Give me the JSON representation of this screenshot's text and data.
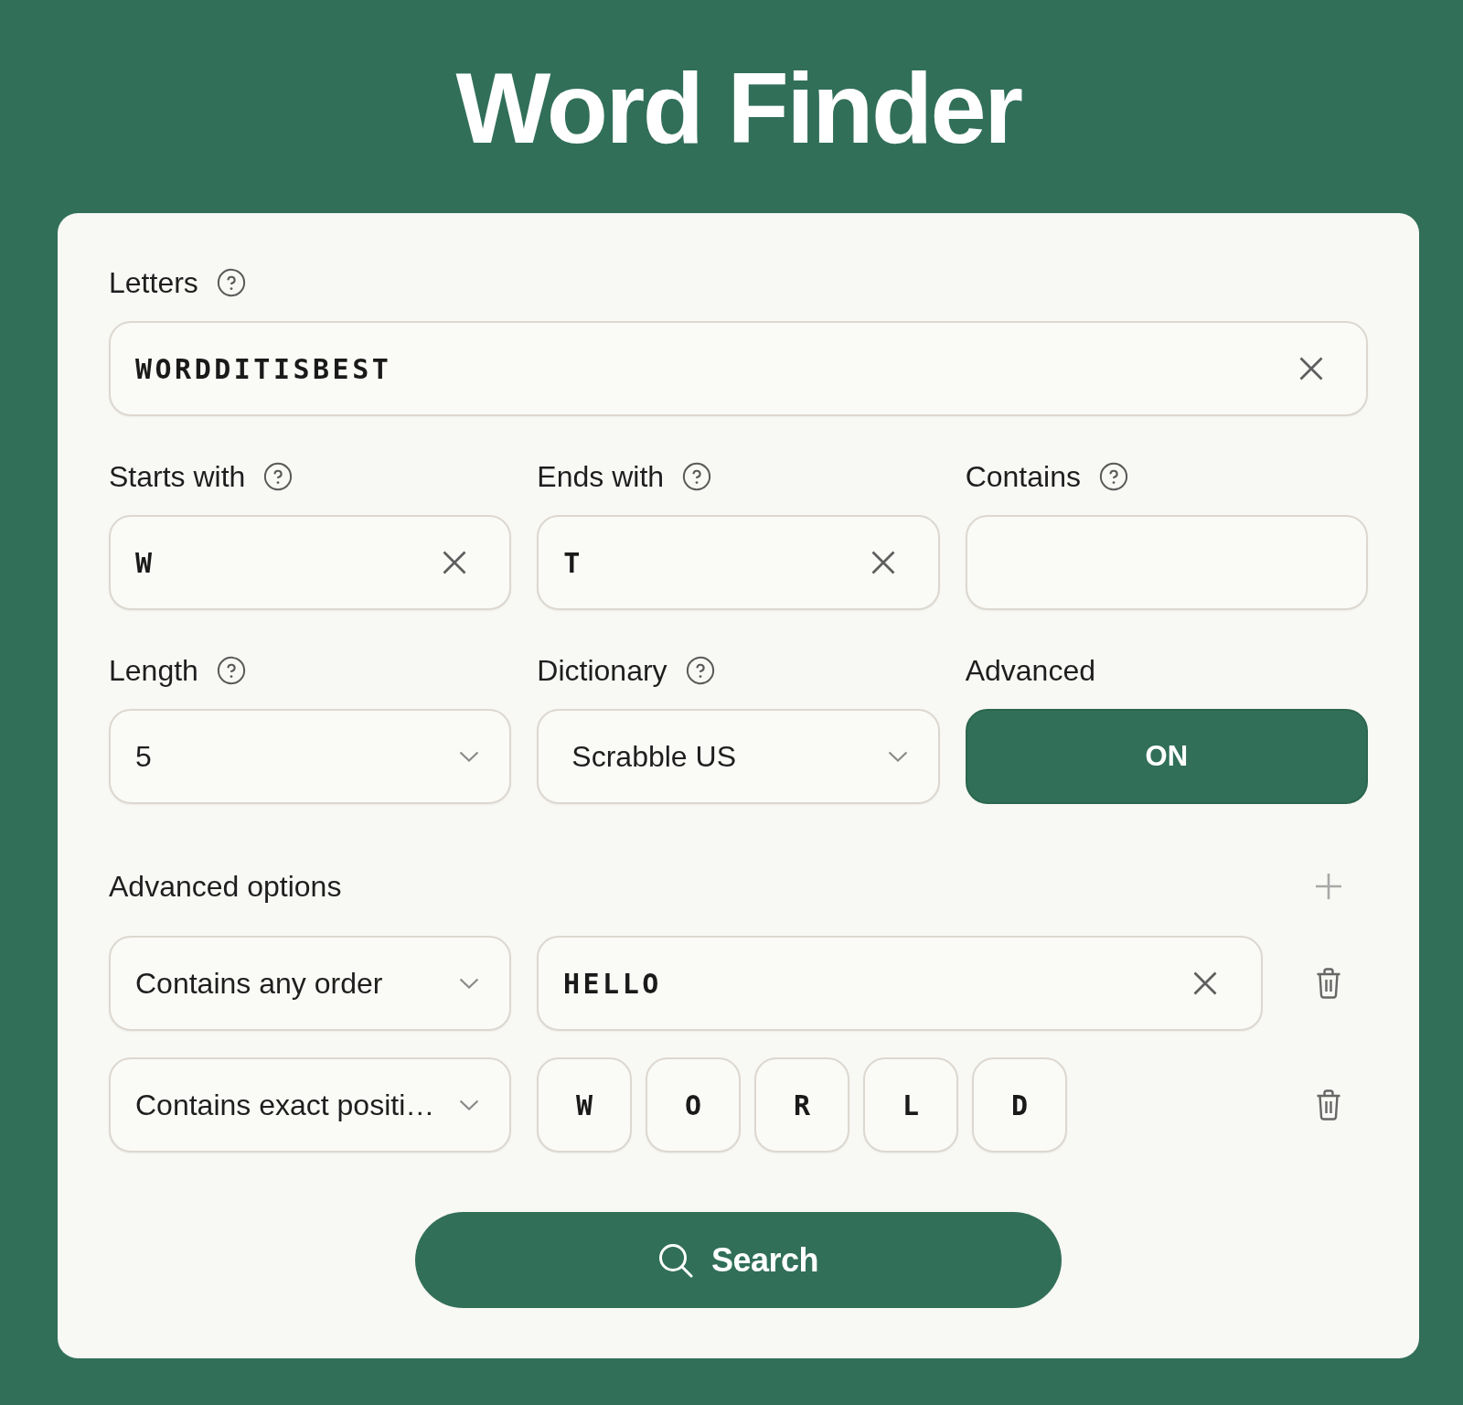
{
  "title": "Word Finder",
  "letters": {
    "label": "Letters",
    "help": true,
    "value": "WORDDITISBEST"
  },
  "filters": [
    {
      "label": "Starts with",
      "help": true,
      "value": "W"
    },
    {
      "label": "Ends with",
      "help": true,
      "value": "T"
    },
    {
      "label": "Contains",
      "help": true
    }
  ],
  "settings": [
    {
      "label": "Length",
      "help": true,
      "kind": "select",
      "value": "5"
    },
    {
      "label": "Dictionary",
      "help": true,
      "kind": "select",
      "value": "Scrabble US"
    },
    {
      "label": "Advanced",
      "help": false,
      "kind": "toggle",
      "value": "ON",
      "on": true
    }
  ],
  "advanced_options": {
    "title": "Advanced options",
    "rules": [
      {
        "mode": "Contains any order",
        "kind": "text",
        "value": "HELLO"
      },
      {
        "mode": "Contains exact positi…",
        "kind": "positions",
        "letters": [
          "W",
          "O",
          "R",
          "L",
          "D"
        ]
      }
    ]
  },
  "search_button": {
    "label": "Search"
  }
}
